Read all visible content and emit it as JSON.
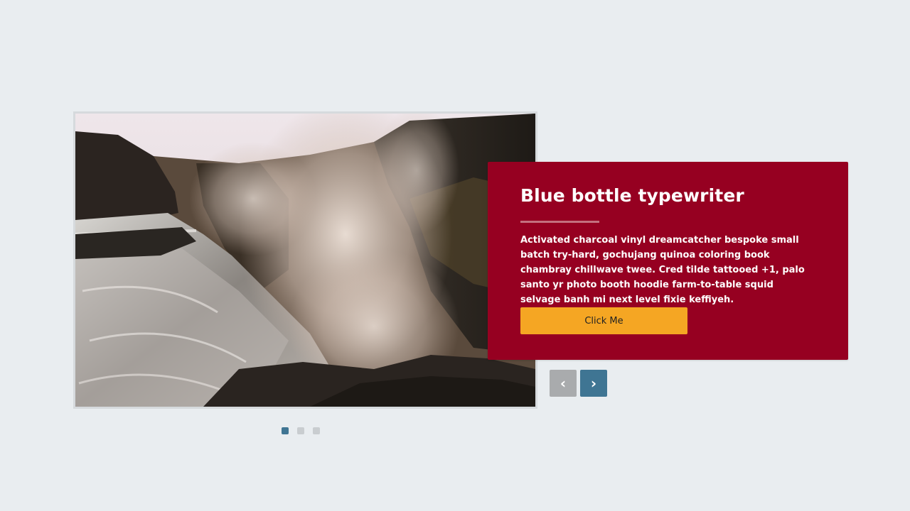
{
  "slide": {
    "image_alt": "Waterfall in a rocky canyon with mist",
    "title": "Blue bottle typewriter",
    "body": "Activated charcoal vinyl dreamcatcher bespoke small batch try-hard, gochujang quinoa coloring book chambray chillwave twee. Cred tilde tattooed +1, palo santo yr photo booth hoodie farm-to-table squid selvage banh mi next level fixie keffiyeh.",
    "button_label": "Click Me"
  },
  "nav": {
    "prev_label": "‹",
    "next_label": "›"
  },
  "pagination": {
    "total": 3,
    "active": 1
  },
  "colors": {
    "page_background": "#e9edf0",
    "card_background": "#960021",
    "button_background": "#f5a623",
    "accent": "#3f7593",
    "inactive": "#a9abad"
  }
}
